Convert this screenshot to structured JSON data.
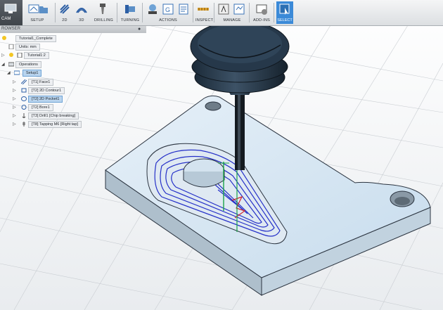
{
  "toolbar": {
    "workspace": "CAM",
    "groups": [
      {
        "label": "SETUP",
        "icon": "setup-icon"
      },
      {
        "label": "2D",
        "icon": "2d-toolpath-icon"
      },
      {
        "label": "3D",
        "icon": "3d-toolpath-icon"
      },
      {
        "label": "DRILLING",
        "icon": "drill-icon"
      },
      {
        "label": "TURNING",
        "icon": "turning-icon"
      },
      {
        "label": "ACTIONS",
        "icon": "actions-icon"
      },
      {
        "label": "INSPECT",
        "icon": "inspect-icon"
      },
      {
        "label": "MANAGE",
        "icon": "manage-icon"
      },
      {
        "label": "ADD-INS",
        "icon": "addins-icon"
      },
      {
        "label": "SELECT",
        "icon": "select-cursor-icon"
      }
    ]
  },
  "browser": {
    "header": "ROWSER",
    "items": [
      {
        "label": "Tutorial1_Complete"
      },
      {
        "label": "Units: mm"
      },
      {
        "label": "Tutorial1:2"
      },
      {
        "label": "Operations"
      },
      {
        "label": "Setup1"
      },
      {
        "label": "[T1] Face1"
      },
      {
        "label": "[T2] 2D Contour1"
      },
      {
        "label": "[T2] 2D Pocket1"
      },
      {
        "label": "[T2] Bore1"
      },
      {
        "label": "[T3] Drill1 [Chip breaking]"
      },
      {
        "label": "[T8] Tapping M6 [Right tap]"
      }
    ]
  },
  "colors": {
    "part": "#cfe1f0",
    "toolpath": "#2530c8",
    "highlight": "#3b8ad8"
  }
}
